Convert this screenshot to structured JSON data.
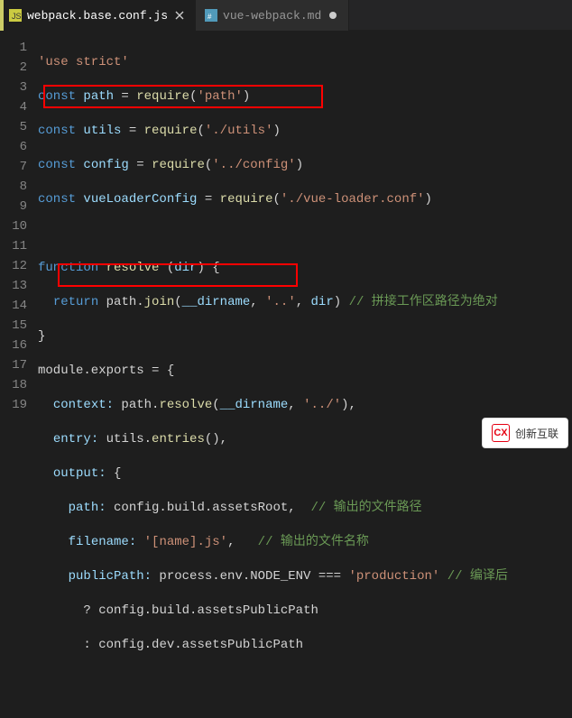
{
  "tabs": [
    {
      "label": "webpack.base.conf.js",
      "icon": "js-file-icon",
      "active": true,
      "dirty": false
    },
    {
      "label": "vue-webpack.md",
      "icon": "md-file-icon",
      "active": false,
      "dirty": true
    }
  ],
  "lines": {
    "n1": "1",
    "n2": "2",
    "n3": "3",
    "n4": "4",
    "n5": "5",
    "n6": "6",
    "n7": "7",
    "n8": "8",
    "n9": "9",
    "n10": "10",
    "n11": "11",
    "n12": "12",
    "n13": "13",
    "n14": "14",
    "n15": "15",
    "n16": "16",
    "n17": "17",
    "n18": "18",
    "n19": "19"
  },
  "c": {
    "l1_str": "'use strict'",
    "l2_kw": "const",
    "l2_id": "path",
    "l2_eq": " = ",
    "l2_fn": "require",
    "l2_p1": "(",
    "l2_str": "'path'",
    "l2_p2": ")",
    "l3_kw": "const",
    "l3_id": "utils",
    "l3_eq": " = ",
    "l3_fn": "require",
    "l3_p1": "(",
    "l3_str": "'./utils'",
    "l3_p2": ")",
    "l4_kw": "const",
    "l4_id": "config",
    "l4_eq": " = ",
    "l4_fn": "require",
    "l4_p1": "(",
    "l4_str": "'../config'",
    "l4_p2": ")",
    "l5_kw": "const",
    "l5_id": "vueLoaderConfig",
    "l5_eq": " = ",
    "l5_fn": "require",
    "l5_p1": "(",
    "l5_str": "'./vue-loader.conf'",
    "l5_p2": ")",
    "l7_kw": "function",
    "l7_fn": "resolve",
    "l7_sp": " ",
    "l7_p1": "(",
    "l7_id": "dir",
    "l7_p2": ") {",
    "l8_kw": "return",
    "l8_a": " path.",
    "l8_fn": "join",
    "l8_p1": "(",
    "l8_id1": "__dirname",
    "l8_c1": ", ",
    "l8_str": "'..'",
    "l8_c2": ", ",
    "l8_id2": "dir",
    "l8_p2": ") ",
    "l8_cm": "// 拼接工作区路径为绝对",
    "l9_p": "}",
    "l10_a": "module.exports = {",
    "l11_key": "context:",
    "l11_a": " path.",
    "l11_fn": "resolve",
    "l11_p1": "(",
    "l11_id": "__dirname",
    "l11_c": ", ",
    "l11_str": "'../'",
    "l11_p2": "),",
    "l12_key": "entry:",
    "l12_a": " utils.",
    "l12_fn": "entries",
    "l12_p": "(),",
    "l13_key": "output:",
    "l13_p": " {",
    "l14_key": "path:",
    "l14_a": " config.build.assetsRoot,  ",
    "l14_cm": "// 输出的文件路径",
    "l15_key": "filename:",
    "l15_sp": " ",
    "l15_str": "'[name].js'",
    "l15_c": ",   ",
    "l15_cm": "// 输出的文件名称",
    "l16_key": "publicPath:",
    "l16_a": " process.env.NODE_ENV === ",
    "l16_str": "'production'",
    "l16_sp": " ",
    "l16_cm": "// 编译后",
    "l17_q": "? ",
    "l17_a": "config.build.assetsPublicPath",
    "l18_q": ": ",
    "l18_a": "config.dev.assetsPublicPath"
  },
  "watermark": "创新互联"
}
